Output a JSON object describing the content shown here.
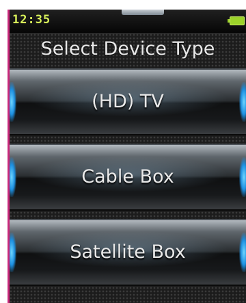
{
  "status_bar": {
    "time": "12:35",
    "battery_icon": "battery-full-icon",
    "battery_color": "#9cd32a"
  },
  "title": "Select Device Type",
  "device_types": [
    {
      "label": "(HD) TV"
    },
    {
      "label": "Cable Box"
    },
    {
      "label": "Satellite Box"
    }
  ],
  "colors": {
    "clock": "#d9f25a",
    "accent_glow": "#1d8fe0"
  }
}
